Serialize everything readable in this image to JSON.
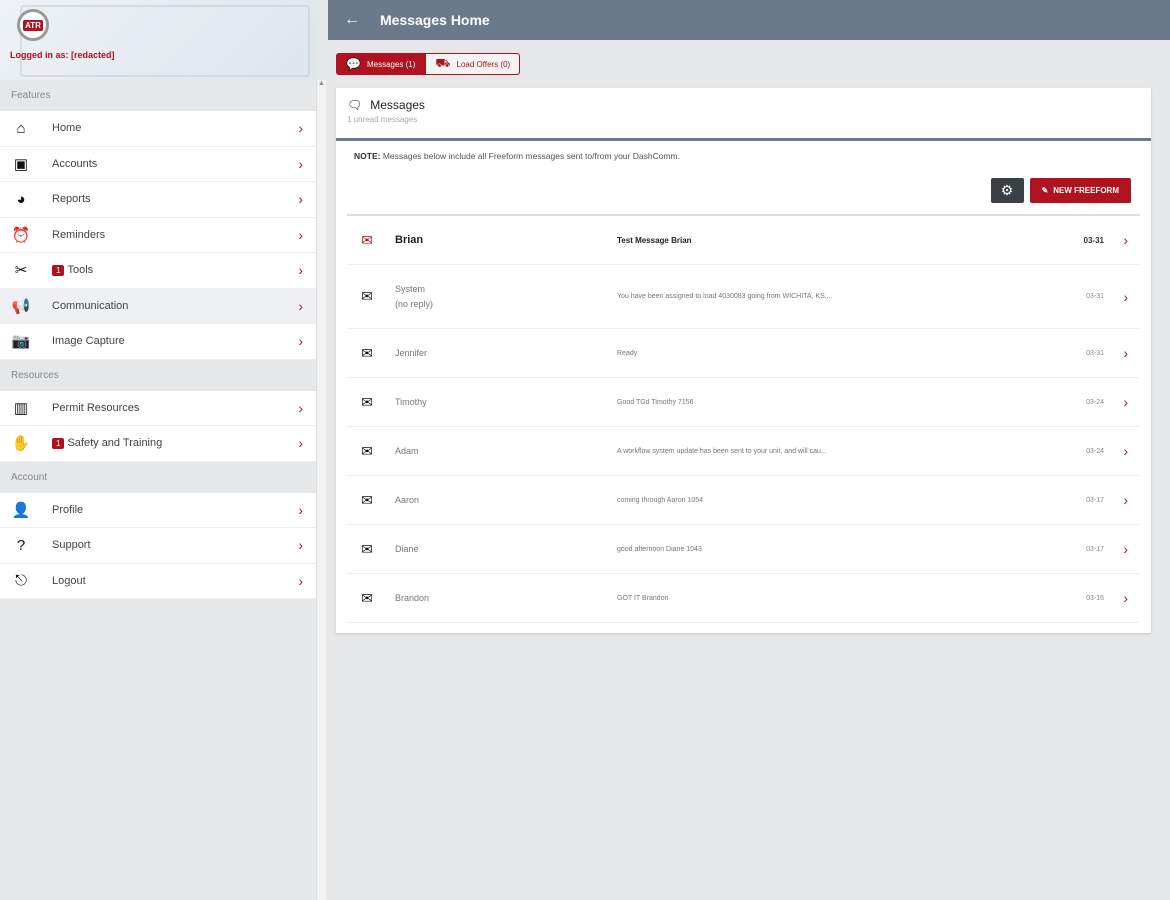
{
  "sidebar": {
    "logo_text": "ATR",
    "logged_in": "Logged in as: [redacted]",
    "sections": [
      {
        "title": "Features",
        "items": [
          {
            "label": "Home",
            "icon": "home-icon",
            "glyph": "⌂"
          },
          {
            "label": "Accounts",
            "icon": "money-icon",
            "glyph": "▣"
          },
          {
            "label": "Reports",
            "icon": "pie-chart-icon",
            "glyph": "◕"
          },
          {
            "label": "Reminders",
            "icon": "alarm-clock-icon",
            "glyph": "⏰"
          },
          {
            "label": "Tools",
            "icon": "tools-icon",
            "glyph": "✂",
            "badge": "1"
          },
          {
            "label": "Communication",
            "icon": "megaphone-icon",
            "glyph": "📢",
            "active": true
          },
          {
            "label": "Image Capture",
            "icon": "camera-icon",
            "glyph": "📷"
          }
        ]
      },
      {
        "title": "Resources",
        "items": [
          {
            "label": "Permit Resources",
            "icon": "map-icon",
            "glyph": "▥"
          },
          {
            "label": "Safety and Training",
            "icon": "hand-icon",
            "glyph": "✋",
            "badge": "1"
          }
        ]
      },
      {
        "title": "Account",
        "items": [
          {
            "label": "Profile",
            "icon": "user-icon",
            "glyph": "👤"
          },
          {
            "label": "Support",
            "icon": "question-icon",
            "glyph": "?"
          },
          {
            "label": "Logout",
            "icon": "logout-icon",
            "glyph": "⎋"
          }
        ]
      }
    ]
  },
  "header": {
    "title": "Messages Home"
  },
  "tabs": [
    {
      "label": "Messages (1)"
    },
    {
      "label": "Load Offers (0)"
    }
  ],
  "card": {
    "title": "Messages",
    "subtitle": "1 unread messages",
    "note_label": "NOTE:",
    "note": " Messages below include all Freeform messages sent to/from your DashComm.",
    "new_button": "NEW FREEFORM"
  },
  "messages": [
    {
      "from": "Brian",
      "sub": "",
      "text": "Test Message Brian",
      "date": "03-31",
      "unread": true
    },
    {
      "from": "System",
      "sub": "(no reply)",
      "text": "You have been assigned to load 4030083 going from WICHITA, KS,...",
      "date": "03-31"
    },
    {
      "from": "Jennifer",
      "sub": "",
      "text": "Ready",
      "date": "03-31"
    },
    {
      "from": "Timothy",
      "sub": "",
      "text": "Good TGd Timothy 7156",
      "date": "03-24"
    },
    {
      "from": "Adam",
      "sub": "",
      "text": "A workflow system update has been sent to your unit, and will cau...",
      "date": "03-24"
    },
    {
      "from": "Aaron",
      "sub": "",
      "text": "coming through Aaron 1054",
      "date": "03-17"
    },
    {
      "from": "Diane",
      "sub": "",
      "text": "good afternoon Diane 1043",
      "date": "03-17"
    },
    {
      "from": "Brandon",
      "sub": "",
      "text": "GOT IT Brandon",
      "date": "03-16"
    }
  ]
}
